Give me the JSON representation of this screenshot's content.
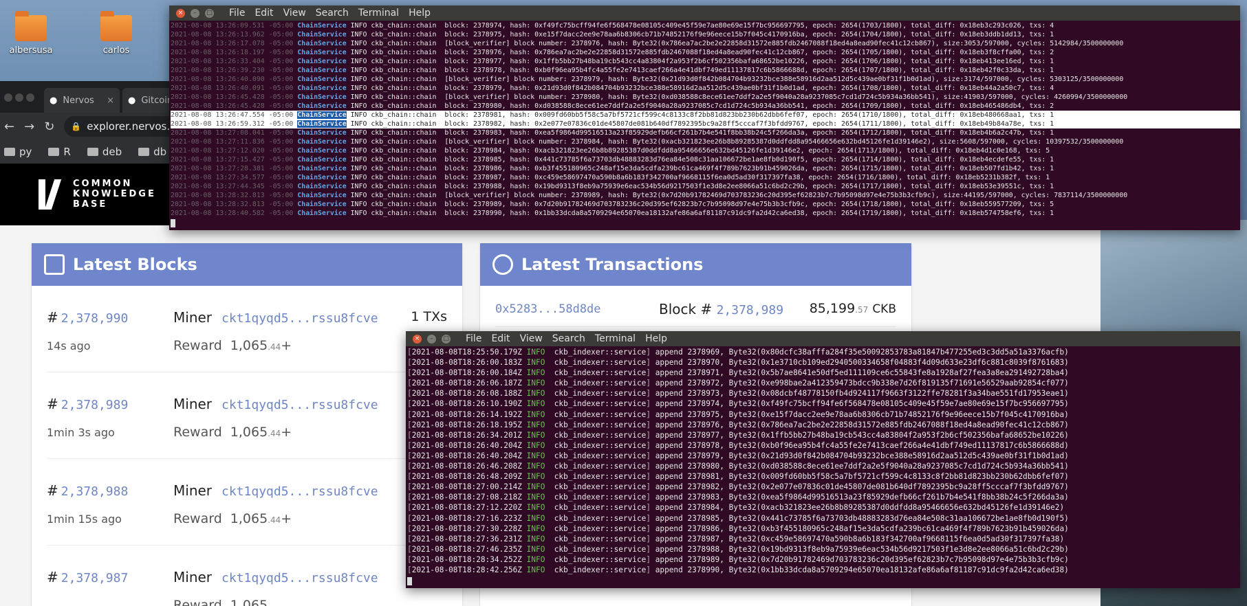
{
  "desktop": {
    "icons": [
      {
        "label": "albersusa"
      },
      {
        "label": "carlos"
      }
    ]
  },
  "browser": {
    "tabs": [
      {
        "label": "Nervos"
      },
      {
        "label": "Gitcoin"
      }
    ],
    "url": "explorer.nervos.org",
    "bookmarks": [
      "py",
      "R",
      "deb",
      "db"
    ],
    "logo_lines": [
      "COMMON",
      "KNOWLEDGE",
      "BASE"
    ],
    "latest_blocks_title": "Latest Blocks",
    "latest_tx_title": "Latest Transactions",
    "blocks": [
      {
        "hash_sym": "#",
        "number": "2,378,990",
        "age": "14s ago",
        "miner_label": "Miner",
        "miner": "ckt1qyqd5...rssu8fcve",
        "reward_label": "Reward",
        "reward": "1,065",
        "reward_dec": ".44",
        "plus": "+",
        "txs": "1 TXs"
      },
      {
        "hash_sym": "#",
        "number": "2,378,989",
        "age": "1min 3s ago",
        "miner_label": "Miner",
        "miner": "ckt1qyqd5...rssu8fcve",
        "reward_label": "Reward",
        "reward": "1,065",
        "reward_dec": ".44",
        "plus": "+",
        "txs": ""
      },
      {
        "hash_sym": "#",
        "number": "2,378,988",
        "age": "1min 15s ago",
        "miner_label": "Miner",
        "miner": "ckt1qyqd5...rssu8fcve",
        "reward_label": "Reward",
        "reward": "1,065",
        "reward_dec": ".44",
        "plus": "+",
        "txs": ""
      },
      {
        "hash_sym": "#",
        "number": "2,378,987",
        "age": "",
        "miner_label": "Miner",
        "miner": "ckt1qyqd5...rssu8fcve",
        "reward_label": "Reward",
        "reward": "1,065",
        "reward_dec": "",
        "plus": "",
        "txs": ""
      }
    ],
    "transaction": {
      "hash": "0x5283...58d8de",
      "block_label": "Block #",
      "block_number": "2,378,989",
      "amount": "85,199",
      "amount_dec": ".57",
      "unit": "CKB"
    }
  },
  "terminal_top": {
    "menu": [
      "File",
      "Edit",
      "View",
      "Search",
      "Terminal",
      "Help"
    ],
    "lines": [
      {
        "ts": "2021-08-08 13:26:09.531 -05:00",
        "svc": "ChainService",
        "msg": "INFO ckb_chain::chain  block: 2378974, hash: 0xf49fc75bcff94fe6f568478e08105c409e45f59e7ae80e69e15f7bc956697795, epoch: 2654(1703/1800), total_diff: 0x18eb3c293c026, txs: 4"
      },
      {
        "ts": "2021-08-08 13:26:13.962 -05:00",
        "svc": "ChainService",
        "msg": "INFO ckb_chain::chain  block: 2378975, hash: 0xe15f7dacc2ee9e78aa6b8306cb71b74852176f9e96eece15b7f045c4170916ba, epoch: 2654(1704/1800), total_diff: 0x18eb3ddb1dd13, txs: 1"
      },
      {
        "ts": "2021-08-08 13:26:17.078 -05:00",
        "svc": "ChainService",
        "msg": "INFO ckb_chain::chain  [block_verifier] block number: 2378976, hash: Byte32(0x786ea7ac2be2e22858d31572e885fdb2467088f18ed4a8ead90fec41c12cb867), size:3053/597000, cycles: 5142984/3500000000"
      },
      {
        "ts": "2021-08-08 13:26:18.197 -05:00",
        "svc": "ChainService",
        "msg": "INFO ckb_chain::chain  block: 2378976, hash: 0x786ea7ac2be2e22858d31572e885fdb2467088f18ed4a8ead90fec41c12cb867, epoch: 2654(1705/1800), total_diff: 0x18eb3f8cffa00, txs: 2"
      },
      {
        "ts": "2021-08-08 13:26:33.404 -05:00",
        "svc": "ChainService",
        "msg": "INFO ckb_chain::chain  block: 2378977, hash: 0x1ffb5bb27b48ba19cb543cc4a83804f2a953f2b6cf502356bafa68652be10226, epoch: 2654(1706/1800), total_diff: 0x18eb413ee16ed, txs: 1"
      },
      {
        "ts": "2021-08-08 13:26:39.230 -05:00",
        "svc": "ChainService",
        "msg": "INFO ckb_chain::chain  block: 2378978, hash: 0xb0f96ea95b4fc4a55fe2e7413caef266a4e41dbf749ed11137817c6b5866688d, epoch: 2654(1707/1800), total_diff: 0x18eb42f0c33da, txs: 1"
      },
      {
        "ts": "2021-08-08 13:26:40.090 -05:00",
        "svc": "ChainService",
        "msg": "INFO ckb_chain::chain  [block_verifier] block number: 2378979, hash: Byte32(0x21d93d0f842b084704b93232bce388e58916d2aa512d5c439ae0bf31f1b0d1ad), size:3174/597000, cycles: 5303125/3500000000"
      },
      {
        "ts": "2021-08-08 13:26:40.091 -05:00",
        "svc": "ChainService",
        "msg": "INFO ckb_chain::chain  block: 2378979, hash: 0x21d93d0f842b084704b93232bce388e58916d2aa512d5c439ae0bf31f1b0d1ad, epoch: 2654(1708/1800), total_diff: 0x18eb44a2a50c7, txs: 4"
      },
      {
        "ts": "2021-08-08 13:26:45.428 -05:00",
        "svc": "ChainService",
        "msg": "INFO ckb_chain::chain  [block_verifier] block number: 2378980, hash: Byte32(0xd038588c8ece61ee7ddf2a2e5f9040a28a9237085c7cd1d724c5b934a36bb541), size:41903/597000, cycles: 4260994/3500000000"
      },
      {
        "ts": "2021-08-08 13:26:45.428 -05:00",
        "svc": "ChainService",
        "msg": "INFO ckb_chain::chain  block: 2378980, hash: 0xd038588c8ece61ee7ddf2a2e5f9040a28a9237085c7cd1d724c5b934a36bb541, epoch: 2654(1709/1800), total_diff: 0x18eb465486db4, txs: 2"
      },
      {
        "ts": "2021-08-08 13:26:47.554 -05:00",
        "svc": "ChainService",
        "msg": "INFO ckb_chain::chain  block: 2378981, hash: 0x009fd60bb5f58c5a7bf5721cf599c4c8133c8f2bb81d823bb230b62dbb6fef07, epoch: 2654(1710/1800), total_diff: 0x18eb480668aa1, txs: 1",
        "hl": true
      },
      {
        "ts": "2021-08-08 13:26:59.312 -05:00",
        "svc": "ChainService",
        "msg": "INFO ckb_chain::chain  block: 2378982, hash: 0x2e077e07836c01de45807de081b640df7892395bc9a28ff5cccaf7f3bfdd9767, epoch: 2654(1711/1800), total_diff: 0x18eb49b84a78e, txs: 1",
        "hl": true
      },
      {
        "ts": "2021-08-08 13:27:08.041 -05:00",
        "svc": "ChainService",
        "msg": "INFO ckb_chain::chain  block: 2378983, hash: 0xea5f9864d99516513a23f85929defb66cf261b7b4e541f8bb38b24c5f266da3a, epoch: 2654(1712/1800), total_diff: 0x18eb4b6a2c47b, txs: 1"
      },
      {
        "ts": "2021-08-08 13:27:11.836 -05:00",
        "svc": "ChainService",
        "msg": "INFO ckb_chain::chain  [block_verifier] block number: 2378984, hash: Byte32(0xacb321823ee26b8b89285387d0ddfdd8a95466656e632bd45126fe1d39146e2), size:5608/597000, cycles: 10397532/3500000000"
      },
      {
        "ts": "2021-08-08 13:27:12.020 -05:00",
        "svc": "ChainService",
        "msg": "INFO ckb_chain::chain  block: 2378984, hash: 0xacb321823ee26b8b89285387d0ddfdd8a95466656e632bd45126fe1d39146e2, epoch: 2654(1713/1800), total_diff: 0x18eb4d1c0e168, txs: 5"
      },
      {
        "ts": "2021-08-08 13:27:15.427 -05:00",
        "svc": "ChainService",
        "msg": "INFO ckb_chain::chain  block: 2378985, hash: 0x441c73785f6a73703db48883283d76ea84e508c31aa106672be1ae8fb0d190f5, epoch: 2654(1714/1800), total_diff: 0x18eb4ecdefe55, txs: 1"
      },
      {
        "ts": "2021-08-08 13:27:28.381 -05:00",
        "svc": "ChainService",
        "msg": "INFO ckb_chain::chain  block: 2378986, hash: 0xb3f455180965c248af15e3da5cdfa239bc61ca469f4f789b7623b91b459026da, epoch: 2654(1715/1800), total_diff: 0x18eb507fd1b42, txs: 1"
      },
      {
        "ts": "2021-08-08 13:27:34.577 -05:00",
        "svc": "ChainService",
        "msg": "INFO ckb_chain::chain  block: 2378987, hash: 0xc459e58697470a590b8a6b183f342700af9668115f6ea0d5ad30f317397fa38, epoch: 2654(1716/1800), total_diff: 0x18eb5231b382f, txs: 1"
      },
      {
        "ts": "2021-08-08 13:27:44.345 -05:00",
        "svc": "ChainService",
        "msg": "INFO ckb_chain::chain  block: 2378988, hash: 0x19bd9313f8eb9a75939e6eac534b56d9217503f1e3d8e2ee8066a51c6bd2c29b, epoch: 2654(1717/1800), total_diff: 0x18eb53e39551c, txs: 1"
      },
      {
        "ts": "2021-08-08 13:28:32.813 -05:00",
        "svc": "ChainService",
        "msg": "INFO ckb_chain::chain  [block_verifier] block number: 2378989, hash: Byte32(0x7d20b91782469d703783236c20d395ef62823b7c7b95098d97e4e75b3b3cfb9c), size:44195/597000, cycles: 7837114/3500000000"
      },
      {
        "ts": "2021-08-08 13:28:32.813 -05:00",
        "svc": "ChainService",
        "msg": "INFO ckb_chain::chain  block: 2378989, hash: 0x7d20b91782469d703783236c20d395ef62823b7c7b95098d97e4e75b3b3cfb9c, epoch: 2654(1718/1800), total_diff: 0x18eb559577209, txs: 5"
      },
      {
        "ts": "2021-08-08 13:28:40.582 -05:00",
        "svc": "ChainService",
        "msg": "INFO ckb_chain::chain  block: 2378990, hash: 0x1bb33dcda8a5709294e65070ea18132afe86a6af81187c91dc9fa2d42ca6ed38, epoch: 2654(1719/1800), total_diff: 0x18eb574758ef6, txs: 1"
      }
    ]
  },
  "terminal_bottom": {
    "menu": [
      "File",
      "Edit",
      "View",
      "Search",
      "Terminal",
      "Help"
    ],
    "lines": [
      {
        "ts": "2021-08-08T18:25:50.179Z",
        "lvl": "INFO",
        "mod": "ckb_indexer::service",
        "msg": "append 2378969, Byte32(0x80dcfc38afffa284f35e50092853783a81847b477255ed3c3dd5a51a3376acfb)"
      },
      {
        "ts": "2021-08-08T18:26:00.183Z",
        "lvl": "INFO",
        "mod": "ckb_indexer::service",
        "msg": "append 2378970, Byte32(0x1e3710cb109ed2940500334658f04883f4d09d633e23df6c881c8039f8761683)"
      },
      {
        "ts": "2021-08-08T18:26:00.184Z",
        "lvl": "INFO",
        "mod": "ckb_indexer::service",
        "msg": "append 2378971, Byte32(0x5b7ae8641e50df5ed111109ce6c55843fe8a1928af27fea3a8ea291492728ba4)"
      },
      {
        "ts": "2021-08-08T18:26:06.187Z",
        "lvl": "INFO",
        "mod": "ckb_indexer::service",
        "msg": "append 2378972, Byte32(0xe998bae2a412359473bdcc9b338e7d26f819135f71691e56529aab92854cf077)"
      },
      {
        "ts": "2021-08-08T18:26:08.188Z",
        "lvl": "INFO",
        "mod": "ckb_indexer::service",
        "msg": "append 2378973, Byte32(0x08dcbf48778150fb4d924117f9663f3122ffe78281f3a34bae551fd17953eae1)"
      },
      {
        "ts": "2021-08-08T18:26:10.190Z",
        "lvl": "INFO",
        "mod": "ckb_indexer::service",
        "msg": "append 2378974, Byte32(0xf49fc75bcff94fe6f568478e08105c409e45f59e7ae80e69e15f7bc956697795)"
      },
      {
        "ts": "2021-08-08T18:26:14.192Z",
        "lvl": "INFO",
        "mod": "ckb_indexer::service",
        "msg": "append 2378975, Byte32(0xe15f7dacc2ee9e78aa6b8306cb71b74852176f9e96eece15b7f045c4170916ba)"
      },
      {
        "ts": "2021-08-08T18:26:18.195Z",
        "lvl": "INFO",
        "mod": "ckb_indexer::service",
        "msg": "append 2378976, Byte32(0x786ea7ac2be2e22858d31572e885fdb2467088f18ed4a8ead90fec41c12cb867)"
      },
      {
        "ts": "2021-08-08T18:26:34.201Z",
        "lvl": "INFO",
        "mod": "ckb_indexer::service",
        "msg": "append 2378977, Byte32(0x1ffb5bb27b48ba19cb543cc4a83804f2a953f2b6cf502356bafa68652be10226)"
      },
      {
        "ts": "2021-08-08T18:26:40.204Z",
        "lvl": "INFO",
        "mod": "ckb_indexer::service",
        "msg": "append 2378978, Byte32(0xb0f96ea95b4fc4a55fe2e7413caef266a4e41dbf749ed11137817c6b5866688d)"
      },
      {
        "ts": "2021-08-08T18:26:40.204Z",
        "lvl": "INFO",
        "mod": "ckb_indexer::service",
        "msg": "append 2378979, Byte32(0x21d93d0f842b084704b93232bce388e58916d2aa512d5c439ae0bf31f1b0d1ad)"
      },
      {
        "ts": "2021-08-08T18:26:46.208Z",
        "lvl": "INFO",
        "mod": "ckb_indexer::service",
        "msg": "append 2378980, Byte32(0xd038588c8ece61ee7ddf2a2e5f9040a28a9237085c7cd1d724c5b934a36bb541)"
      },
      {
        "ts": "2021-08-08T18:26:48.209Z",
        "lvl": "INFO",
        "mod": "ckb_indexer::service",
        "msg": "append 2378981, Byte32(0x009fd60bb5f58c5a7bf5721cf599c4c8133c8f2bb81d823bb230b62dbb6fef07)"
      },
      {
        "ts": "2021-08-08T18:27:00.214Z",
        "lvl": "INFO",
        "mod": "ckb_indexer::service",
        "msg": "append 2378982, Byte32(0x2e077e07836c01de45807de081b640df7892395bc9a28ff5cccaf7f3bfdd9767)"
      },
      {
        "ts": "2021-08-08T18:27:08.218Z",
        "lvl": "INFO",
        "mod": "ckb_indexer::service",
        "msg": "append 2378983, Byte32(0xea5f9864d99516513a23f85929defb66cf261b7b4e541f8bb38b24c5f266da3a)"
      },
      {
        "ts": "2021-08-08T18:27:12.220Z",
        "lvl": "INFO",
        "mod": "ckb_indexer::service",
        "msg": "append 2378984, Byte32(0xacb321823ee26b8b89285387d0ddfdd8a95466656e632bd45126fe1d39146e2)"
      },
      {
        "ts": "2021-08-08T18:27:16.223Z",
        "lvl": "INFO",
        "mod": "ckb_indexer::service",
        "msg": "append 2378985, Byte32(0x441c73785f6a73703db48883283d76ea84e508c31aa106672be1ae8fb0d190f5)"
      },
      {
        "ts": "2021-08-08T18:27:30.228Z",
        "lvl": "INFO",
        "mod": "ckb_indexer::service",
        "msg": "append 2378986, Byte32(0xb3f455180965c248af15e3da5cdfa239bc61ca469f4f789b7623b91b459026da)"
      },
      {
        "ts": "2021-08-08T18:27:36.231Z",
        "lvl": "INFO",
        "mod": "ckb_indexer::service",
        "msg": "append 2378987, Byte32(0xc459e58697470a590b8a6b183f342700af9668115f6ea0d5ad30f317397fa38)"
      },
      {
        "ts": "2021-08-08T18:27:46.235Z",
        "lvl": "INFO",
        "mod": "ckb_indexer::service",
        "msg": "append 2378988, Byte32(0x19bd9313f8eb9a75939e6eac534b56d9217503f1e3d8e2ee8066a51c6bd2c29b)"
      },
      {
        "ts": "2021-08-08T18:28:34.252Z",
        "lvl": "INFO",
        "mod": "ckb_indexer::service",
        "msg": "append 2378989, Byte32(0x7d20b91782469d703783236c20d395ef62823b7c7b95098d97e4e75b3b3cfb9c)"
      },
      {
        "ts": "2021-08-08T18:28:42.256Z",
        "lvl": "INFO",
        "mod": "ckb_indexer::service",
        "msg": "append 2378990, Byte32(0x1bb33dcda8a5709294e65070ea18132afe86a6af81187c91dc9fa2d42ca6ed38)"
      }
    ]
  }
}
